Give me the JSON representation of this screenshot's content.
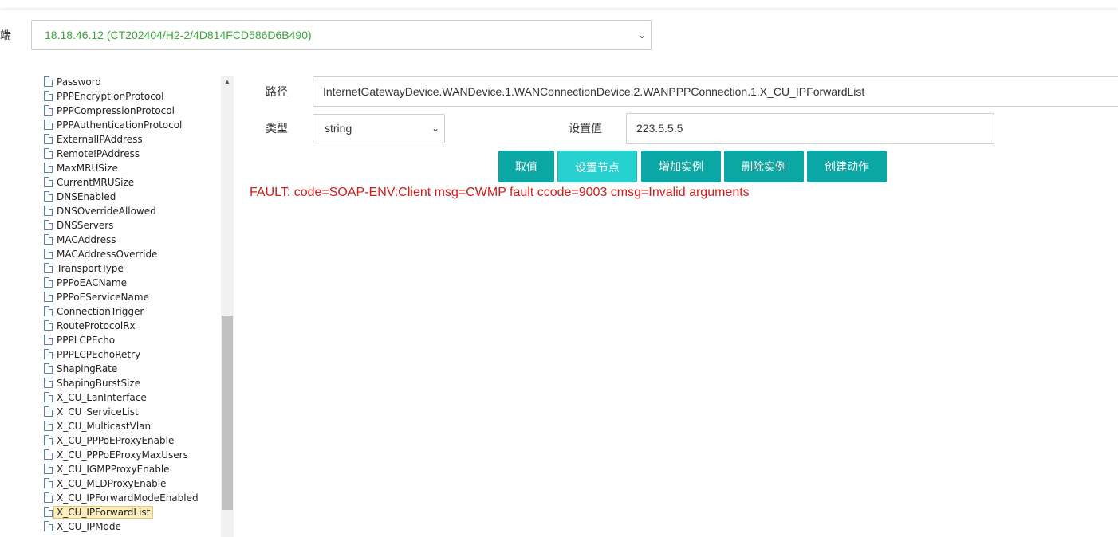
{
  "header": {
    "device_label": "端",
    "device_value": "18.18.46.12 (CT202404/H2-2/4D814FCD586D6B490)"
  },
  "tree": {
    "items": [
      "Password",
      "PPPEncryptionProtocol",
      "PPPCompressionProtocol",
      "PPPAuthenticationProtocol",
      "ExternalIPAddress",
      "RemoteIPAddress",
      "MaxMRUSize",
      "CurrentMRUSize",
      "DNSEnabled",
      "DNSOverrideAllowed",
      "DNSServers",
      "MACAddress",
      "MACAddressOverride",
      "TransportType",
      "PPPoEACName",
      "PPPoEServiceName",
      "ConnectionTrigger",
      "RouteProtocolRx",
      "PPPLCPEcho",
      "PPPLCPEchoRetry",
      "ShapingRate",
      "ShapingBurstSize",
      "X_CU_LanInterface",
      "X_CU_ServiceList",
      "X_CU_MulticastVlan",
      "X_CU_PPPoEProxyEnable",
      "X_CU_PPPoEProxyMaxUsers",
      "X_CU_IGMPProxyEnable",
      "X_CU_MLDProxyEnable",
      "X_CU_IPForwardModeEnabled",
      "X_CU_IPForwardList",
      "X_CU_IPMode"
    ],
    "selected_index": 30
  },
  "form": {
    "path_label": "路径",
    "path_value": "InternetGatewayDevice.WANDevice.1.WANConnectionDevice.2.WANPPPConnection.1.X_CU_IPForwardList",
    "type_label": "类型",
    "type_value": "string",
    "value_label": "设置值",
    "value_value": "223.5.5.5"
  },
  "buttons": {
    "get": "取值",
    "set": "设置节点",
    "add": "增加实例",
    "delete": "删除实例",
    "create": "创建动作"
  },
  "result": {
    "fault_text": "FAULT: code=SOAP-ENV:Client msg=CWMP fault ccode=9003 cmsg=Invalid arguments"
  },
  "colors": {
    "button": "#0aa7a5",
    "button_active": "#26d1cf",
    "fault": "#d41b1b",
    "device_text": "#3aa43a"
  }
}
